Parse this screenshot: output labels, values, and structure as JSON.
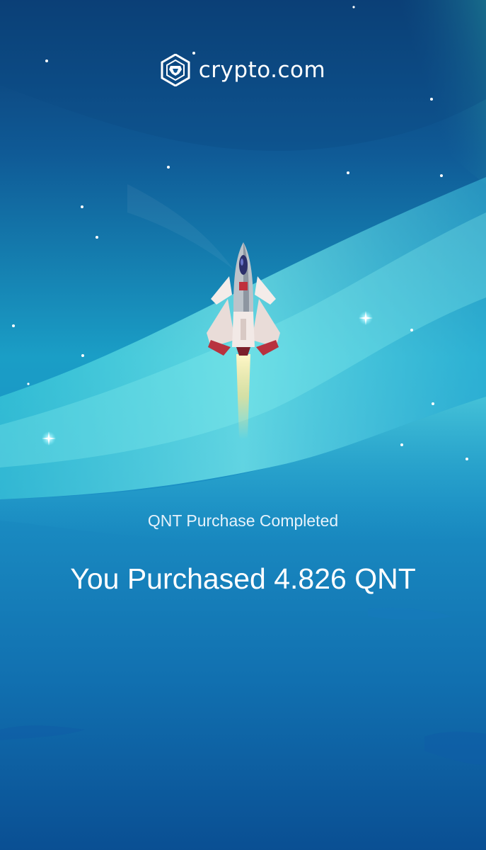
{
  "brand": {
    "name": "crypto.com",
    "logo_icon": "crypto-com-lion-shield-icon"
  },
  "illustration": {
    "subject": "rocket-icon",
    "decorations": "stars-and-sparkles"
  },
  "status": {
    "title": "QNT Purchase Completed",
    "message": "You Purchased 4.826 QNT"
  },
  "colors": {
    "background_top": "#0b3f78",
    "background_mid": "#1a9ec6",
    "background_bottom": "#0a4f8f",
    "aurora": "#5fe3e6",
    "text": "#ffffff"
  }
}
